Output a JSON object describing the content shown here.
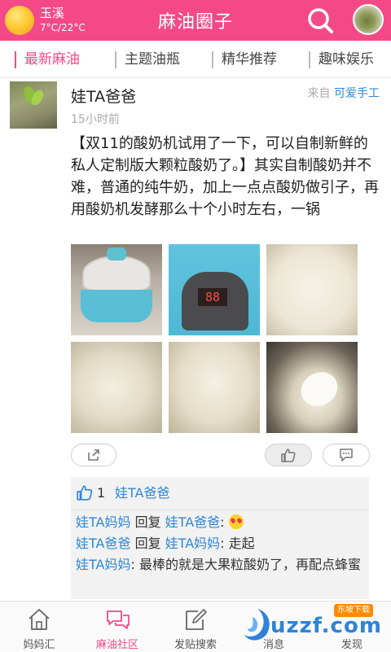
{
  "header": {
    "city": "玉溪",
    "temperature": "7°C/22°C",
    "title": "麻油圈子",
    "accent_color": "#f34a87"
  },
  "tabs": [
    {
      "label": "最新麻油",
      "active": true
    },
    {
      "label": "主题油瓶",
      "active": false
    },
    {
      "label": "精华推荐",
      "active": false
    },
    {
      "label": "趣味娱乐",
      "active": false
    }
  ],
  "post": {
    "author": "娃TA爸爸",
    "time": "15小时前",
    "from_prefix": "来自",
    "from_source": "可爱手工",
    "content": "【双11的酸奶机试用了一下，可以自制新鲜的私人定制版大颗粒酸奶了。】其实自制酸奶并不难，普通的纯牛奶，加上一点点酸奶做引子，再用酸奶机发酵那么十个小时左右，一锅",
    "led_display": "88",
    "photo_count": 6
  },
  "likes": {
    "count": "1",
    "users": "娃TA爸爸"
  },
  "comments": [
    {
      "user": "娃TA妈妈",
      "action": "回复",
      "target": "娃TA爸爸",
      "text": ":",
      "emoji": "heart-eyes-emoji"
    },
    {
      "user": "娃TA爸爸",
      "action": "回复",
      "target": "娃TA妈妈",
      "text": ": 走起"
    },
    {
      "user": "娃TA妈妈",
      "text": ": 最棒的就是大果粒酸奶了，再配点蜂蜜"
    }
  ],
  "bottom_nav": [
    {
      "label": "妈妈汇",
      "icon": "house-icon",
      "active": false
    },
    {
      "label": "麻油社区",
      "icon": "chat-bubbles-icon",
      "active": true
    },
    {
      "label": "发贴搜索",
      "icon": "edit-icon",
      "active": false
    },
    {
      "label": "消息",
      "icon": "message-icon",
      "active": false
    },
    {
      "label": "发现",
      "icon": "discover-icon",
      "active": false
    }
  ],
  "watermark": {
    "text": "uzzf.com",
    "tag": "东坡下载"
  }
}
